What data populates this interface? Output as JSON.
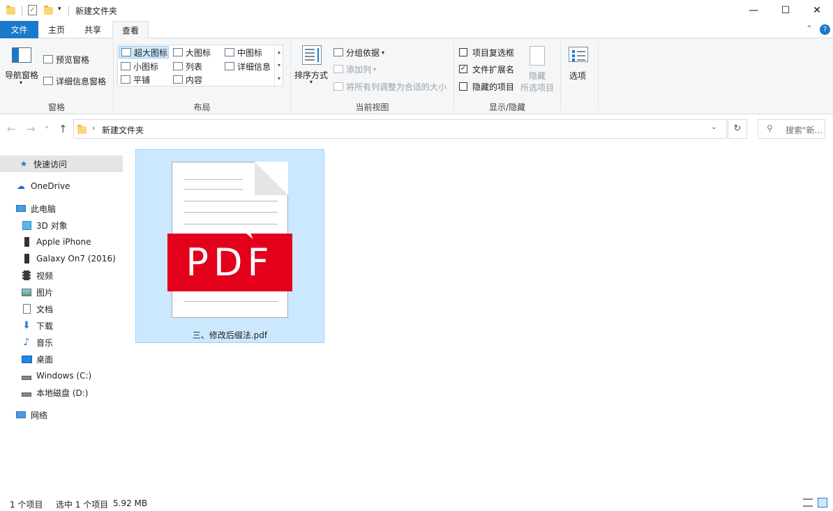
{
  "window": {
    "title": "新建文件夹",
    "controls": {
      "minimize": "—",
      "maximize": "☐",
      "close": "✕"
    }
  },
  "ribbon_tabs": {
    "file": "文件",
    "home": "主页",
    "share": "共享",
    "view": "查看",
    "collapse": "⌃",
    "help": "?"
  },
  "ribbon": {
    "panes": {
      "nav_pane": "导航窗格",
      "preview_pane": "预览窗格",
      "details_pane": "详细信息窗格",
      "group_label": "窗格"
    },
    "layout": {
      "items": [
        "超大图标",
        "大图标",
        "中图标",
        "小图标",
        "列表",
        "详细信息",
        "平铺",
        "内容"
      ],
      "selected": "超大图标",
      "group_label": "布局"
    },
    "current_view": {
      "sort_by": "排序方式",
      "group_by": "分组依据",
      "add_columns": "添加列",
      "size_all_columns": "将所有列调整为合适的大小",
      "group_label": "当前视图"
    },
    "show_hide": {
      "item_checkboxes": {
        "label": "项目复选框",
        "checked": false
      },
      "file_extensions": {
        "label": "文件扩展名",
        "checked": true
      },
      "hidden_items": {
        "label": "隐藏的项目",
        "checked": false
      },
      "hide_selected_line1": "隐藏",
      "hide_selected_line2": "所选项目",
      "group_label": "显示/隐藏"
    },
    "options": "选项"
  },
  "address": {
    "path": "新建文件夹",
    "search_placeholder": "搜索\"新..."
  },
  "sidebar": {
    "items": [
      {
        "label": "快速访问",
        "icon": "star-icon"
      },
      {
        "label": "OneDrive",
        "icon": "cloud-icon"
      },
      {
        "label": "此电脑",
        "icon": "computer-icon"
      },
      {
        "label": "3D 对象",
        "icon": "cube-icon"
      },
      {
        "label": "Apple iPhone",
        "icon": "phone-icon"
      },
      {
        "label": "Galaxy On7 (2016)",
        "icon": "phone-icon"
      },
      {
        "label": "视频",
        "icon": "film-icon"
      },
      {
        "label": "图片",
        "icon": "picture-icon"
      },
      {
        "label": "文档",
        "icon": "document-icon"
      },
      {
        "label": "下载",
        "icon": "download-icon"
      },
      {
        "label": "音乐",
        "icon": "music-icon"
      },
      {
        "label": "桌面",
        "icon": "desktop-icon"
      },
      {
        "label": "Windows (C:)",
        "icon": "drive-icon"
      },
      {
        "label": "本地磁盘 (D:)",
        "icon": "drive-icon"
      },
      {
        "label": "网络",
        "icon": "network-icon"
      }
    ]
  },
  "files": [
    {
      "name": "三、修改后缀法.pdf",
      "badge": "PDF",
      "selected": true
    }
  ],
  "status": {
    "item_count": "1 个项目",
    "selection": "选中 1 个项目",
    "size": "5.92 MB"
  },
  "colors": {
    "file_tab": "#1979ca",
    "selection": "#cce8ff",
    "pdf_red": "#e2001a"
  }
}
